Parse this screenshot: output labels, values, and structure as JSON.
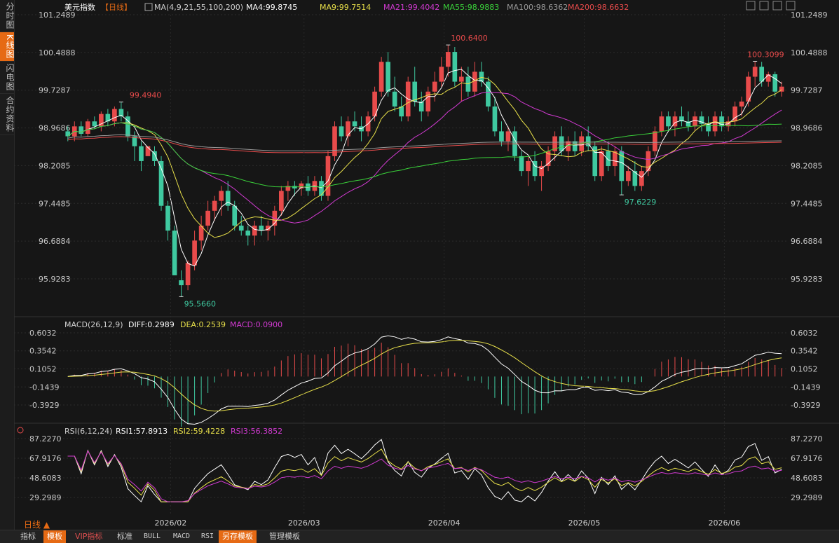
{
  "sidebar": {
    "tabs": [
      {
        "label": "分时图",
        "active": false
      },
      {
        "label": "K线图",
        "active": true
      },
      {
        "label": "闪电图",
        "active": false
      },
      {
        "label": "合约资料",
        "active": false
      }
    ]
  },
  "header": {
    "instrument": "美元指数",
    "period": "【日线】",
    "ma_params": "MA(4,9,21,55,100,200)",
    "ma_values": [
      {
        "label": "MA4:99.8745",
        "color": "#ffffff"
      },
      {
        "label": "MA9:99.7514",
        "color": "#e8e04a"
      },
      {
        "label": "MA21:99.4042",
        "color": "#d23ad2"
      },
      {
        "label": "MA55:98.9883",
        "color": "#3ad23a"
      },
      {
        "label": "MA100:98.6362",
        "color": "#9a9a9a"
      },
      {
        "label": "MA200:98.6632",
        "color": "#e84b4b"
      }
    ]
  },
  "price_axis": [
    "101.2489",
    "100.4888",
    "99.7287",
    "98.9686",
    "98.2085",
    "97.4485",
    "96.6884",
    "95.9283"
  ],
  "macd_axis": [
    "0.6032",
    "0.3542",
    "0.1052",
    "-0.1439",
    "-0.3929"
  ],
  "rsi_axis": [
    "87.2270",
    "67.9176",
    "48.6083",
    "29.2989"
  ],
  "x_dates": [
    "2026/02",
    "2026/03",
    "2026/04",
    "2026/05",
    "2026/06"
  ],
  "annotations": [
    "99.4940",
    "95.5660",
    "100.6400",
    "97.6229",
    "100.3099"
  ],
  "macd": {
    "title": "MACD(26,12,9)",
    "diff": "DIFF:0.2989",
    "dea": "DEA:0.2539",
    "macd": "MACD:0.0900"
  },
  "rsi": {
    "title": "RSI(6,12,24)",
    "rsi1": "RSI1:57.8913",
    "rsi2": "RSI2:59.4228",
    "rsi3": "RSI3:56.3852"
  },
  "period_selector": "日线 ▲",
  "bottom_tabs": [
    "指标",
    "模板",
    "VIP指标",
    "标准",
    "BULL",
    "MACD",
    "RSI",
    "另存模板",
    "管理模板"
  ],
  "colors": {
    "up": "#e84b4b",
    "down": "#3fc9a0",
    "accent": "#e66a14",
    "ma4": "#ffffff",
    "ma9": "#e8e04a",
    "ma21": "#d23ad2",
    "ma55": "#3ad23a",
    "ma100": "#9a9a9a",
    "ma200": "#e84b4b"
  },
  "chart_data": {
    "type": "candlestick",
    "ylim": [
      95.5,
      101.3
    ],
    "candles": [
      [
        98.9,
        99.0,
        98.7,
        98.8
      ],
      [
        98.8,
        99.1,
        98.7,
        99.0
      ],
      [
        99.0,
        99.1,
        98.8,
        98.85
      ],
      [
        98.85,
        99.15,
        98.8,
        99.1
      ],
      [
        99.1,
        99.2,
        98.95,
        99.0
      ],
      [
        99.0,
        99.3,
        98.9,
        99.25
      ],
      [
        99.25,
        99.35,
        99.0,
        99.1
      ],
      [
        99.1,
        99.4,
        99.0,
        99.35
      ],
      [
        99.35,
        99.49,
        99.1,
        99.2
      ],
      [
        99.2,
        99.3,
        98.7,
        98.8
      ],
      [
        98.8,
        98.9,
        98.3,
        98.6
      ],
      [
        98.6,
        98.7,
        98.1,
        98.3
      ],
      [
        98.4,
        98.6,
        98.5,
        98.6
      ],
      [
        98.5,
        98.6,
        98.2,
        98.3
      ],
      [
        98.3,
        98.4,
        97.3,
        97.4
      ],
      [
        97.4,
        97.5,
        96.7,
        96.9
      ],
      [
        96.9,
        97.0,
        96.0,
        96.0
      ],
      [
        95.9,
        96.1,
        95.57,
        95.8
      ],
      [
        95.8,
        96.3,
        95.7,
        96.25
      ],
      [
        96.2,
        96.9,
        96.1,
        96.7
      ],
      [
        96.7,
        97.2,
        96.5,
        97.0
      ],
      [
        97.0,
        97.5,
        96.9,
        97.3
      ],
      [
        97.3,
        97.6,
        97.1,
        97.5
      ],
      [
        97.5,
        97.8,
        97.2,
        97.7
      ],
      [
        97.7,
        97.9,
        97.3,
        97.4
      ],
      [
        97.4,
        97.5,
        96.9,
        97.0
      ],
      [
        97.0,
        97.2,
        96.8,
        96.9
      ],
      [
        96.9,
        97.0,
        96.6,
        96.8
      ],
      [
        96.8,
        97.1,
        96.6,
        97.0
      ],
      [
        97.0,
        97.2,
        96.8,
        96.9
      ],
      [
        96.9,
        97.1,
        96.7,
        97.0
      ],
      [
        97.0,
        97.4,
        96.8,
        97.3
      ],
      [
        97.3,
        97.8,
        97.2,
        97.7
      ],
      [
        97.7,
        97.9,
        97.5,
        97.8
      ],
      [
        97.8,
        97.9,
        97.6,
        97.75
      ],
      [
        97.75,
        97.9,
        97.6,
        97.85
      ],
      [
        97.85,
        98.0,
        97.6,
        97.7
      ],
      [
        97.7,
        98.0,
        97.6,
        97.9
      ],
      [
        97.9,
        98.0,
        97.5,
        97.6
      ],
      [
        97.6,
        98.5,
        97.5,
        98.4
      ],
      [
        98.4,
        99.1,
        98.3,
        99.0
      ],
      [
        99.0,
        99.2,
        98.7,
        98.8
      ],
      [
        98.8,
        99.2,
        98.6,
        99.1
      ],
      [
        99.1,
        99.3,
        98.9,
        99.0
      ],
      [
        99.0,
        99.2,
        98.7,
        98.9
      ],
      [
        98.9,
        99.3,
        98.8,
        99.2
      ],
      [
        99.2,
        99.8,
        99.1,
        99.7
      ],
      [
        99.7,
        100.4,
        99.6,
        100.3
      ],
      [
        100.3,
        100.5,
        99.6,
        99.7
      ],
      [
        99.7,
        100.0,
        99.3,
        99.4
      ],
      [
        99.4,
        99.6,
        99.1,
        99.2
      ],
      [
        99.2,
        100.0,
        99.1,
        99.9
      ],
      [
        99.9,
        100.2,
        99.4,
        99.5
      ],
      [
        99.5,
        99.7,
        99.1,
        99.3
      ],
      [
        99.3,
        99.8,
        99.2,
        99.7
      ],
      [
        99.7,
        100.1,
        99.5,
        99.9
      ],
      [
        99.9,
        100.4,
        99.8,
        100.2
      ],
      [
        100.2,
        100.64,
        100.0,
        100.5
      ],
      [
        100.5,
        100.6,
        99.8,
        99.9
      ],
      [
        99.9,
        100.2,
        99.5,
        100.0
      ],
      [
        100.0,
        100.2,
        99.6,
        99.7
      ],
      [
        99.7,
        100.3,
        99.6,
        100.1
      ],
      [
        100.1,
        100.3,
        99.8,
        99.9
      ],
      [
        99.9,
        100.0,
        99.3,
        99.4
      ],
      [
        99.4,
        99.6,
        98.8,
        98.9
      ],
      [
        98.9,
        99.1,
        98.6,
        98.7
      ],
      [
        98.7,
        99.0,
        98.5,
        98.9
      ],
      [
        98.9,
        99.0,
        98.3,
        98.4
      ],
      [
        98.4,
        98.5,
        98.0,
        98.1
      ],
      [
        98.1,
        98.4,
        97.8,
        98.3
      ],
      [
        98.3,
        98.5,
        97.9,
        98.0
      ],
      [
        98.0,
        98.3,
        97.7,
        98.2
      ],
      [
        98.2,
        98.6,
        98.1,
        98.5
      ],
      [
        98.5,
        98.9,
        98.3,
        98.8
      ],
      [
        98.8,
        99.0,
        98.4,
        98.5
      ],
      [
        98.5,
        98.8,
        98.3,
        98.7
      ],
      [
        98.7,
        98.9,
        98.4,
        98.5
      ],
      [
        98.5,
        98.9,
        98.4,
        98.8
      ],
      [
        98.8,
        99.0,
        98.5,
        98.6
      ],
      [
        98.6,
        98.7,
        97.9,
        98.0
      ],
      [
        98.0,
        98.6,
        97.9,
        98.5
      ],
      [
        98.5,
        98.7,
        98.1,
        98.2
      ],
      [
        98.2,
        98.6,
        98.0,
        98.5
      ],
      [
        98.5,
        98.6,
        97.62,
        97.9
      ],
      [
        97.9,
        98.2,
        97.8,
        98.1
      ],
      [
        98.1,
        98.3,
        97.7,
        97.8
      ],
      [
        97.8,
        98.2,
        97.7,
        98.1
      ],
      [
        98.1,
        98.6,
        98.0,
        98.5
      ],
      [
        98.5,
        99.0,
        98.4,
        98.9
      ],
      [
        98.9,
        99.3,
        98.8,
        99.2
      ],
      [
        99.2,
        99.3,
        98.9,
        99.0
      ],
      [
        99.0,
        99.3,
        98.8,
        99.2
      ],
      [
        99.2,
        99.4,
        99.0,
        99.1
      ],
      [
        99.1,
        99.3,
        98.9,
        99.0
      ],
      [
        99.0,
        99.3,
        98.9,
        99.2
      ],
      [
        99.2,
        99.3,
        98.9,
        99.05
      ],
      [
        99.05,
        99.2,
        98.8,
        98.9
      ],
      [
        98.9,
        99.3,
        98.8,
        99.2
      ],
      [
        99.2,
        99.3,
        98.9,
        99.0
      ],
      [
        99.0,
        99.2,
        98.9,
        99.1
      ],
      [
        99.1,
        99.5,
        99.0,
        99.4
      ],
      [
        99.4,
        99.6,
        99.2,
        99.5
      ],
      [
        99.5,
        100.1,
        99.4,
        100.0
      ],
      [
        100.0,
        100.31,
        99.8,
        100.2
      ],
      [
        100.2,
        100.3,
        99.8,
        99.9
      ],
      [
        99.9,
        100.1,
        99.8,
        100.05
      ],
      [
        100.05,
        100.1,
        99.6,
        99.7
      ],
      [
        99.7,
        99.9,
        99.6,
        99.8
      ]
    ]
  }
}
